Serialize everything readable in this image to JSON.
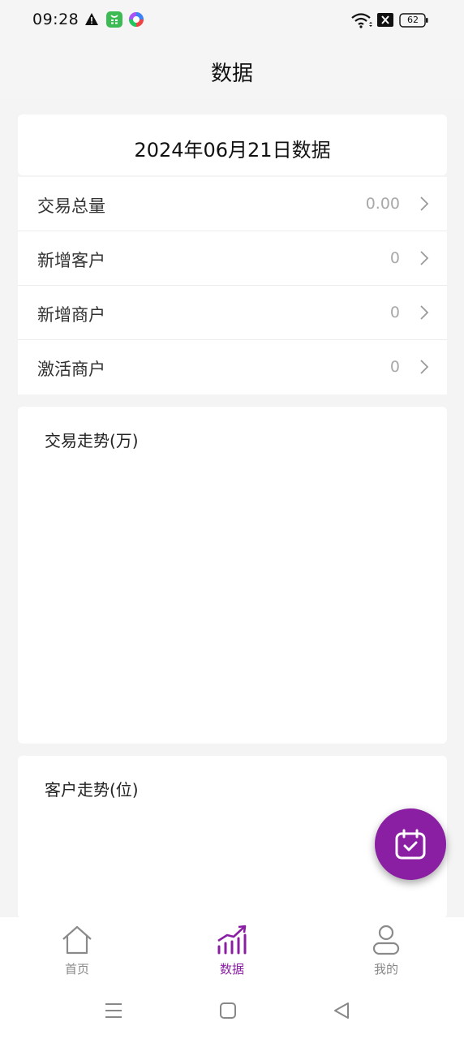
{
  "status_bar": {
    "time": "09:28",
    "battery": "62",
    "icons": [
      "warning-icon",
      "wechat-icon",
      "color-wheel-icon",
      "wifi-icon",
      "x-box-icon",
      "battery-icon"
    ]
  },
  "header": {
    "title": "数据"
  },
  "date_card": {
    "title": "2024年06月21日数据"
  },
  "stats": [
    {
      "label": "交易总量",
      "value": "0.00"
    },
    {
      "label": "新增客户",
      "value": "0"
    },
    {
      "label": "新增商户",
      "value": "0"
    },
    {
      "label": "激活商户",
      "value": "0"
    }
  ],
  "charts": [
    {
      "title": "交易走势(万)"
    },
    {
      "title": "客户走势(位)"
    }
  ],
  "fab": {
    "icon": "calendar-check-icon",
    "color": "#8b1fa3"
  },
  "bottom_nav": [
    {
      "label": "首页",
      "icon": "home-icon",
      "active": false
    },
    {
      "label": "数据",
      "icon": "chart-trend-icon",
      "active": true
    },
    {
      "label": "我的",
      "icon": "person-icon",
      "active": false
    }
  ],
  "colors": {
    "accent": "#8b1fa3",
    "background": "#f4f4f4"
  }
}
